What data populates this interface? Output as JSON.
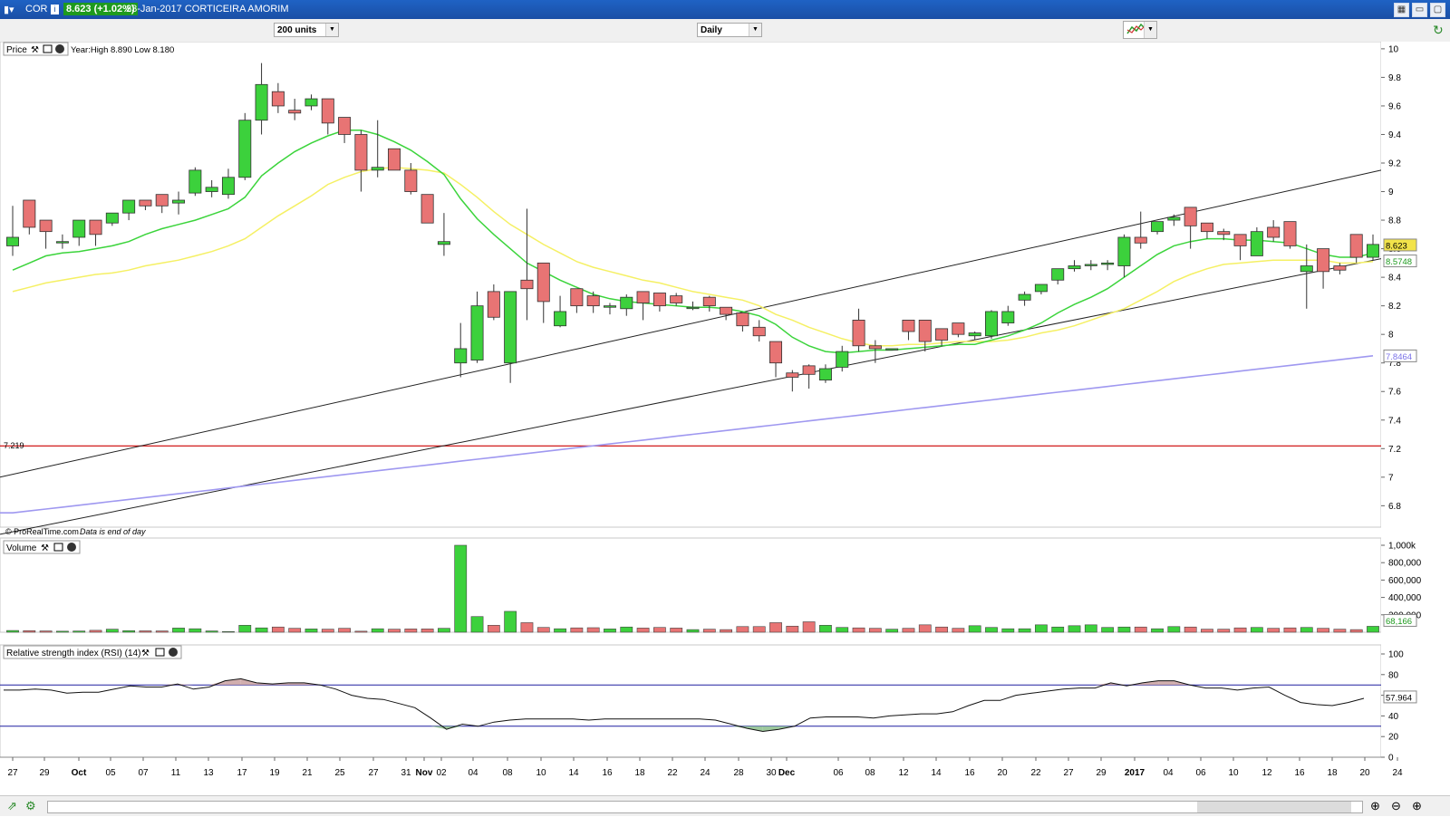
{
  "window": {
    "symbol": "COR",
    "price_badge": "8.623 (+1.02%)",
    "title": "23-Jan-2017  CORTICEIRA AMORIM"
  },
  "toolbar": {
    "units": "200 units",
    "period": "Daily"
  },
  "price_panel": {
    "label": "Price",
    "year_info": "Year:High 8.890 Low 8.180",
    "credit": "© ProRealTime.com",
    "credit_note": "Data is end of day",
    "support_label": "7.219",
    "last_price": "8.623",
    "ma_fast_value": "8.5748",
    "ma_slow_value": "7.8464",
    "yticks": [
      "10",
      "9.8",
      "9.6",
      "9.4",
      "9.2",
      "9",
      "8.8",
      "8.6",
      "8.4",
      "8.2",
      "8",
      "7.8",
      "7.6",
      "7.4",
      "7.2",
      "7",
      "6.8"
    ]
  },
  "volume_panel": {
    "label": "Volume",
    "current": "68,166",
    "yticks": [
      "1,000k",
      "800,000",
      "600,000",
      "400,000",
      "200,000"
    ]
  },
  "rsi_panel": {
    "label": "Relative strength index (RSI) (14)",
    "current": "57.964",
    "yticks": [
      "100",
      "80",
      "60",
      "40",
      "20",
      "0"
    ]
  },
  "xaxis_labels": [
    "27",
    "29",
    "Oct",
    "05",
    "07",
    "11",
    "13",
    "17",
    "19",
    "21",
    "25",
    "27",
    "31",
    "Nov",
    "02",
    "04",
    "08",
    "10",
    "14",
    "16",
    "18",
    "22",
    "24",
    "28",
    "30",
    "Dec",
    "06",
    "08",
    "12",
    "14",
    "16",
    "20",
    "22",
    "27",
    "29",
    "2017",
    "04",
    "06",
    "10",
    "12",
    "16",
    "18",
    "20",
    "24"
  ],
  "colors": {
    "up": "#3cd13c",
    "down": "#e87474",
    "ma_fast": "#3bd43b",
    "ma_slow": "#f5f064",
    "ma_long": "#9f98f0",
    "support": "#cc0000",
    "rsi_band": "#1f1fa0"
  },
  "chart_data": [
    {
      "type": "candlestick",
      "title": "",
      "y_scale": "price",
      "ylim": [
        6.65,
        10.05
      ],
      "ohlc": [
        [
          8.62,
          8.9,
          8.55,
          8.68
        ],
        [
          8.94,
          8.94,
          8.7,
          8.75
        ],
        [
          8.8,
          8.8,
          8.6,
          8.72
        ],
        [
          8.65,
          8.7,
          8.6,
          8.65
        ],
        [
          8.68,
          8.8,
          8.62,
          8.8
        ],
        [
          8.8,
          8.8,
          8.62,
          8.7
        ],
        [
          8.78,
          8.85,
          8.76,
          8.85
        ],
        [
          8.85,
          8.94,
          8.8,
          8.94
        ],
        [
          8.94,
          8.94,
          8.87,
          8.9
        ],
        [
          8.98,
          8.98,
          8.85,
          8.9
        ],
        [
          8.92,
          9,
          8.84,
          8.94
        ],
        [
          8.99,
          9.17,
          8.97,
          9.15
        ],
        [
          9.0,
          9.08,
          8.96,
          9.03
        ],
        [
          8.98,
          9.16,
          8.95,
          9.1
        ],
        [
          9.1,
          9.55,
          9.08,
          9.5
        ],
        [
          9.5,
          9.9,
          9.4,
          9.75
        ],
        [
          9.7,
          9.76,
          9.55,
          9.6
        ],
        [
          9.57,
          9.65,
          9.5,
          9.55
        ],
        [
          9.6,
          9.68,
          9.57,
          9.65
        ],
        [
          9.65,
          9.65,
          9.4,
          9.48
        ],
        [
          9.52,
          9.52,
          9.34,
          9.4
        ],
        [
          9.4,
          9.43,
          9.0,
          9.15
        ],
        [
          9.15,
          9.5,
          9.1,
          9.17
        ],
        [
          9.3,
          9.3,
          9.15,
          9.15
        ],
        [
          9.15,
          9.2,
          8.98,
          9.0
        ],
        [
          8.98,
          8.98,
          8.78,
          8.78
        ],
        [
          8.63,
          8.85,
          8.55,
          8.65
        ],
        [
          7.8,
          8.08,
          7.7,
          7.9
        ],
        [
          7.82,
          8.3,
          7.8,
          8.2
        ],
        [
          8.3,
          8.35,
          8.1,
          8.12
        ],
        [
          7.8,
          8.3,
          7.66,
          8.3
        ],
        [
          8.38,
          8.88,
          8.1,
          8.32
        ],
        [
          8.5,
          8.5,
          8.08,
          8.23
        ],
        [
          8.06,
          8.27,
          8.05,
          8.16
        ],
        [
          8.32,
          8.32,
          8.15,
          8.2
        ],
        [
          8.27,
          8.3,
          8.15,
          8.2
        ],
        [
          8.19,
          8.22,
          8.14,
          8.2
        ],
        [
          8.18,
          8.28,
          8.13,
          8.26
        ],
        [
          8.3,
          8.3,
          8.1,
          8.22
        ],
        [
          8.29,
          8.29,
          8.16,
          8.2
        ],
        [
          8.27,
          8.29,
          8.2,
          8.22
        ],
        [
          8.19,
          8.23,
          8.17,
          8.19
        ],
        [
          8.26,
          8.27,
          8.16,
          8.2
        ],
        [
          8.19,
          8.19,
          8.1,
          8.14
        ],
        [
          8.15,
          8.15,
          8.02,
          8.06
        ],
        [
          8.05,
          8.1,
          7.95,
          7.99
        ],
        [
          7.95,
          7.95,
          7.7,
          7.8
        ],
        [
          7.73,
          7.75,
          7.6,
          7.7
        ],
        [
          7.78,
          7.79,
          7.62,
          7.72
        ],
        [
          7.68,
          7.79,
          7.66,
          7.76
        ],
        [
          7.77,
          7.92,
          7.74,
          7.88
        ],
        [
          8.1,
          8.18,
          7.88,
          7.92
        ],
        [
          7.92,
          7.96,
          7.8,
          7.9
        ],
        [
          7.9,
          7.9,
          7.9,
          7.9
        ],
        [
          8.1,
          8.1,
          7.96,
          8.02
        ],
        [
          8.1,
          8.1,
          7.88,
          7.95
        ],
        [
          8.04,
          8.04,
          7.92,
          7.96
        ],
        [
          8.08,
          8.08,
          7.98,
          8.0
        ],
        [
          7.99,
          8.02,
          7.96,
          8.01
        ],
        [
          7.99,
          8.17,
          7.97,
          8.16
        ],
        [
          8.08,
          8.2,
          8.06,
          8.16
        ],
        [
          8.24,
          8.3,
          8.2,
          8.28
        ],
        [
          8.3,
          8.35,
          8.28,
          8.35
        ],
        [
          8.38,
          8.45,
          8.35,
          8.46
        ],
        [
          8.46,
          8.52,
          8.44,
          8.48
        ],
        [
          8.49,
          8.52,
          8.45,
          8.49
        ],
        [
          8.49,
          8.52,
          8.45,
          8.5
        ],
        [
          8.48,
          8.7,
          8.4,
          8.68
        ],
        [
          8.68,
          8.86,
          8.6,
          8.64
        ],
        [
          8.72,
          8.78,
          8.7,
          8.79
        ],
        [
          8.8,
          8.84,
          8.76,
          8.82
        ],
        [
          8.89,
          8.89,
          8.6,
          8.76
        ],
        [
          8.78,
          8.78,
          8.67,
          8.72
        ],
        [
          8.72,
          8.74,
          8.66,
          8.7
        ],
        [
          8.7,
          8.7,
          8.52,
          8.62
        ],
        [
          8.55,
          8.75,
          8.55,
          8.72
        ],
        [
          8.75,
          8.8,
          8.65,
          8.68
        ],
        [
          8.79,
          8.79,
          8.6,
          8.62
        ],
        [
          8.44,
          8.63,
          8.18,
          8.48
        ],
        [
          8.6,
          8.6,
          8.32,
          8.44
        ],
        [
          8.48,
          8.5,
          8.42,
          8.45
        ],
        [
          8.7,
          8.7,
          8.5,
          8.54
        ],
        [
          8.54,
          8.7,
          8.52,
          8.63
        ]
      ],
      "ma_fast": [
        8.45,
        8.5,
        8.55,
        8.57,
        8.58,
        8.6,
        8.62,
        8.65,
        8.7,
        8.74,
        8.77,
        8.8,
        8.84,
        8.88,
        8.96,
        9.11,
        9.2,
        9.28,
        9.34,
        9.39,
        9.43,
        9.43,
        9.4,
        9.35,
        9.29,
        9.21,
        9.12,
        8.95,
        8.81,
        8.7,
        8.6,
        8.5,
        8.44,
        8.38,
        8.33,
        8.28,
        8.25,
        8.23,
        8.22,
        8.21,
        8.2,
        8.19,
        8.19,
        8.18,
        8.16,
        8.13,
        8.07,
        7.98,
        7.92,
        7.88,
        7.87,
        7.88,
        7.89,
        7.89,
        7.9,
        7.91,
        7.92,
        7.93,
        7.93,
        7.96,
        7.99,
        8.03,
        8.08,
        8.15,
        8.21,
        8.26,
        8.32,
        8.4,
        8.48,
        8.56,
        8.62,
        8.65,
        8.67,
        8.67,
        8.66,
        8.66,
        8.65,
        8.64,
        8.6,
        8.56,
        8.54,
        8.54,
        8.57
      ],
      "ma_slow": [
        8.3,
        8.33,
        8.36,
        8.38,
        8.4,
        8.42,
        8.43,
        8.45,
        8.48,
        8.5,
        8.52,
        8.55,
        8.58,
        8.62,
        8.67,
        8.75,
        8.83,
        8.9,
        8.97,
        9.05,
        9.1,
        9.14,
        9.16,
        9.17,
        9.16,
        9.15,
        9.13,
        9.05,
        8.96,
        8.86,
        8.77,
        8.7,
        8.63,
        8.57,
        8.51,
        8.47,
        8.44,
        8.41,
        8.38,
        8.36,
        8.33,
        8.3,
        8.28,
        8.26,
        8.24,
        8.2,
        8.14,
        8.1,
        8.05,
        8.01,
        7.97,
        7.94,
        7.92,
        7.92,
        7.93,
        7.93,
        7.94,
        7.95,
        7.95,
        7.95,
        7.96,
        7.98,
        8.01,
        8.03,
        8.06,
        8.1,
        8.14,
        8.18,
        8.24,
        8.3,
        8.37,
        8.42,
        8.46,
        8.49,
        8.5,
        8.51,
        8.52,
        8.52,
        8.52,
        8.52,
        8.5,
        8.5,
        8.51
      ],
      "ma_long_start": 6.75,
      "ma_long_end": 7.85,
      "channel_lines": [
        {
          "y_start": 7.0,
          "y_end": 9.15
        },
        {
          "y_start": 6.6,
          "y_end": 8.53
        }
      ],
      "support_line": 7.219
    },
    {
      "type": "bar",
      "title": "",
      "ylim": [
        0,
        1000000
      ],
      "values": [
        20000,
        18000,
        15000,
        12000,
        14000,
        22000,
        35000,
        18000,
        16000,
        15000,
        48000,
        40000,
        15000,
        8000,
        80000,
        50000,
        60000,
        45000,
        38000,
        35000,
        45000,
        12000,
        40000,
        35000,
        38000,
        38000,
        45000,
        1000000,
        180000,
        80000,
        240000,
        110000,
        55000,
        40000,
        50000,
        52000,
        38000,
        60000,
        48000,
        55000,
        48000,
        30000,
        35000,
        30000,
        65000,
        65000,
        110000,
        70000,
        120000,
        80000,
        55000,
        50000,
        45000,
        35000,
        45000,
        85000,
        60000,
        45000,
        75000,
        55000,
        40000,
        40000,
        85000,
        60000,
        75000,
        85000,
        55000,
        60000,
        60000,
        40000,
        65000,
        60000,
        35000,
        35000,
        50000,
        55000,
        45000,
        50000,
        55000,
        45000,
        35000,
        30000,
        68166
      ]
    },
    {
      "type": "line",
      "title": "",
      "ylim": [
        0,
        100
      ],
      "bands": [
        70,
        30
      ],
      "values": [
        65,
        65,
        66,
        65,
        62,
        63,
        63,
        66,
        69,
        68,
        68,
        71,
        66,
        68,
        74,
        76,
        72,
        71,
        72,
        72,
        70,
        66,
        60,
        57,
        56,
        52,
        48,
        38,
        27,
        32,
        30,
        34,
        36,
        37,
        37,
        37,
        37,
        36,
        37,
        37,
        37,
        37,
        37,
        37,
        37,
        36,
        32,
        28,
        25,
        27,
        30,
        38,
        39,
        39,
        39,
        38,
        40,
        41,
        42,
        42,
        44,
        50,
        55,
        55,
        60,
        62,
        64,
        66,
        67,
        67,
        72,
        69,
        72,
        74,
        74,
        70,
        67,
        67,
        65,
        67,
        68,
        60,
        53,
        51,
        50,
        53,
        57
      ]
    }
  ]
}
